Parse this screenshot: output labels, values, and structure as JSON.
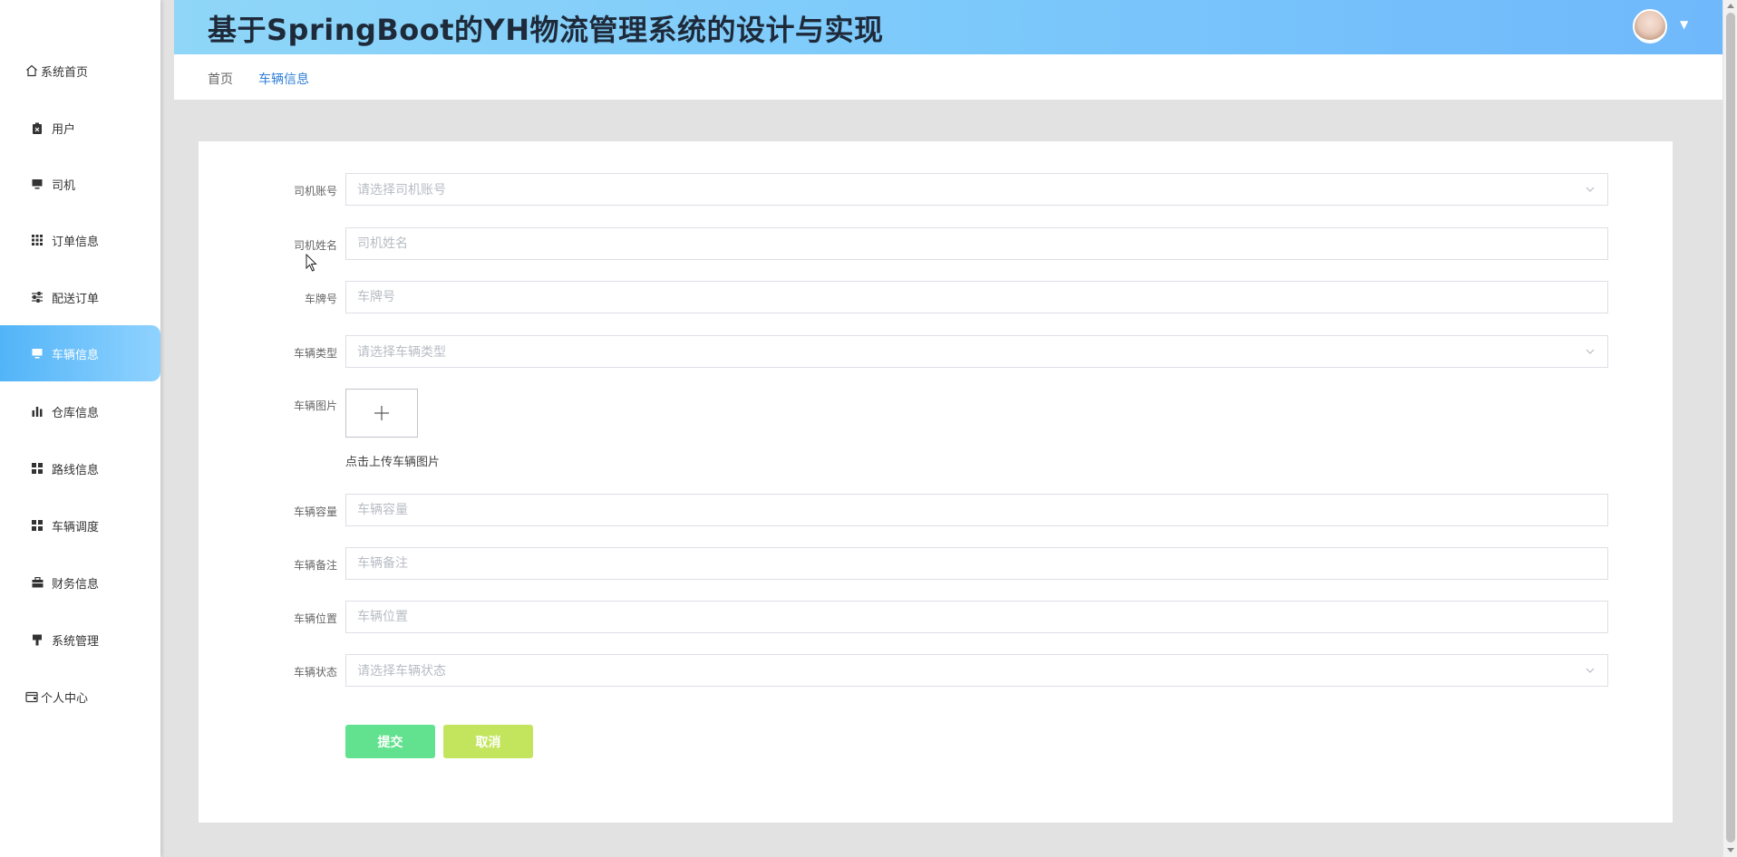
{
  "header": {
    "title": "基于SpringBoot的YH物流管理系统的设计与实现",
    "avatar_caret": "▼"
  },
  "sidebar": {
    "items": [
      {
        "label": "系统首页",
        "icon": "home-icon"
      },
      {
        "label": "用户",
        "icon": "clipboard-icon"
      },
      {
        "label": "司机",
        "icon": "monitor-icon"
      },
      {
        "label": "订单信息",
        "icon": "grid-icon"
      },
      {
        "label": "配送订单",
        "icon": "sliders-icon"
      },
      {
        "label": "车辆信息",
        "icon": "monitor-icon",
        "active": true
      },
      {
        "label": "仓库信息",
        "icon": "bar-chart-icon"
      },
      {
        "label": "路线信息",
        "icon": "apps-icon"
      },
      {
        "label": "车辆调度",
        "icon": "apps-icon"
      },
      {
        "label": "财务信息",
        "icon": "briefcase-icon"
      },
      {
        "label": "系统管理",
        "icon": "flag-icon"
      },
      {
        "label": "个人中心",
        "icon": "wallet-icon"
      }
    ]
  },
  "breadcrumb": {
    "home": "首页",
    "current": "车辆信息"
  },
  "form": {
    "driver_account": {
      "label": "司机账号",
      "placeholder": "请选择司机账号"
    },
    "driver_name": {
      "label": "司机姓名",
      "placeholder": "司机姓名"
    },
    "plate": {
      "label": "车牌号",
      "placeholder": "车牌号"
    },
    "vehicle_type": {
      "label": "车辆类型",
      "placeholder": "请选择车辆类型"
    },
    "vehicle_image": {
      "label": "车辆图片",
      "hint": "点击上传车辆图片",
      "plus": "+"
    },
    "capacity": {
      "label": "车辆容量",
      "placeholder": "车辆容量"
    },
    "remark": {
      "label": "车辆备注",
      "placeholder": "车辆备注"
    },
    "location": {
      "label": "车辆位置",
      "placeholder": "车辆位置"
    },
    "status": {
      "label": "车辆状态",
      "placeholder": "请选择车辆状态"
    }
  },
  "buttons": {
    "submit": "提交",
    "cancel": "取消"
  },
  "colors": {
    "header_gradient_start": "#8fd6f8",
    "header_gradient_end": "#6fb8fb",
    "active_nav": "#52b4f8",
    "submit": "#62e28e",
    "cancel": "#c3e55e",
    "breadcrumb_current": "#2e7fd6"
  }
}
